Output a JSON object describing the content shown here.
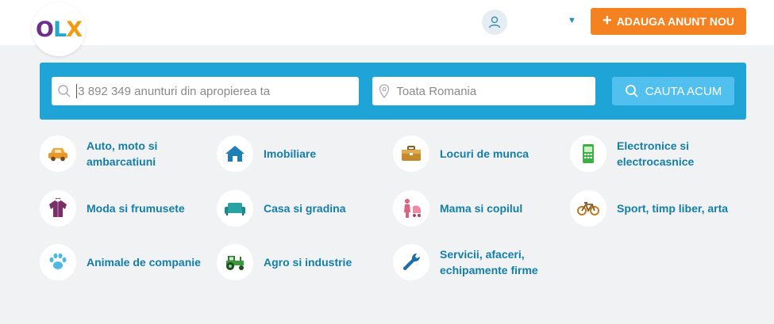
{
  "header": {
    "logo": {
      "o": "O",
      "l": "L",
      "x": "X",
      "icon": "olx-logo"
    },
    "user_icon": "user-icon",
    "post_button": {
      "plus": "+",
      "label": "ADAUGA ANUNT NOU",
      "color": "#f58220"
    }
  },
  "search": {
    "query_placeholder": "3 892 349 anunturi din apropierea ta",
    "location_placeholder": "Toata Romania",
    "button_label": "CAUTA ACUM",
    "bar_color": "#1fa4d7",
    "button_color": "#52c0ee"
  },
  "categories": [
    {
      "label": "Auto, moto si ambarcatiuni",
      "icon": "car-icon"
    },
    {
      "label": "Imobiliare",
      "icon": "house-icon"
    },
    {
      "label": "Locuri de munca",
      "icon": "briefcase-icon"
    },
    {
      "label": "Electronice si electrocasnice",
      "icon": "phone-icon"
    },
    {
      "label": "Moda si frumusete",
      "icon": "jacket-icon"
    },
    {
      "label": "Casa si gradina",
      "icon": "sofa-icon"
    },
    {
      "label": "Mama si copilul",
      "icon": "mother-stroller-icon"
    },
    {
      "label": "Sport, timp liber, arta",
      "icon": "bicycle-icon"
    },
    {
      "label": "Animale de companie",
      "icon": "paw-icon"
    },
    {
      "label": "Agro si industrie",
      "icon": "tractor-icon"
    },
    {
      "label": "Servicii, afaceri, echipamente firme",
      "icon": "wrench-icon"
    }
  ],
  "colors": {
    "category_text": "#137ea8",
    "background": "#f1f2f3"
  }
}
